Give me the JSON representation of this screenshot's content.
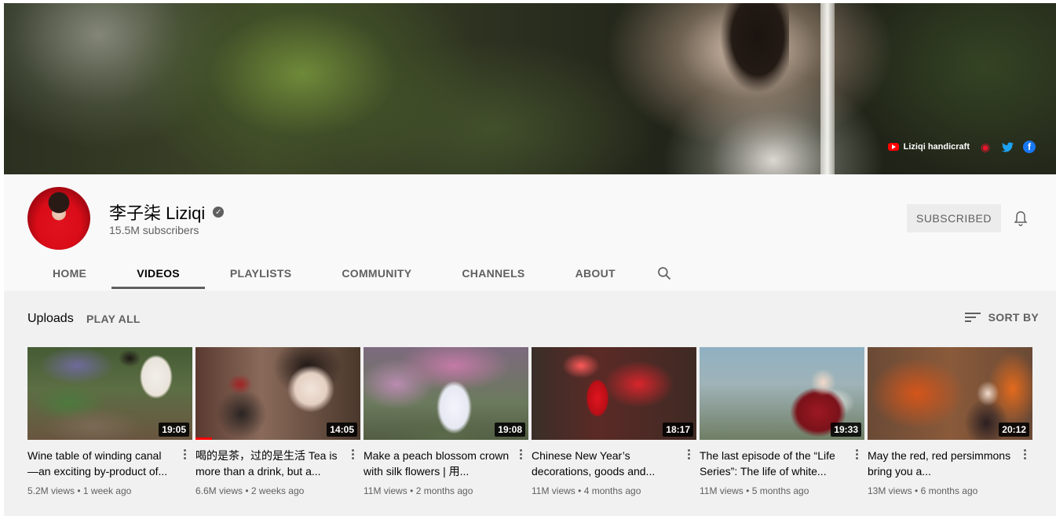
{
  "banner": {
    "links": [
      {
        "icon": "youtube-icon",
        "label": "Liziqi handicraft"
      },
      {
        "icon": "weibo-icon"
      },
      {
        "icon": "twitter-icon"
      },
      {
        "icon": "facebook-icon"
      }
    ]
  },
  "channel": {
    "name": "李子柒 Liziqi",
    "subscribers": "15.5M subscribers",
    "subscribe_button": "SUBSCRIBED",
    "verified_glyph": "✓"
  },
  "tabs": [
    {
      "label": "HOME",
      "active": false
    },
    {
      "label": "VIDEOS",
      "active": true
    },
    {
      "label": "PLAYLISTS",
      "active": false
    },
    {
      "label": "COMMUNITY",
      "active": false
    },
    {
      "label": "CHANNELS",
      "active": false
    },
    {
      "label": "ABOUT",
      "active": false
    }
  ],
  "uploads": {
    "label": "Uploads",
    "play_all": "PLAY ALL",
    "sort_by": "SORT BY"
  },
  "videos": [
    {
      "title": "Wine table of winding canal —an exciting by-product of...",
      "duration": "19:05",
      "views": "5.2M views",
      "age": "1 week ago"
    },
    {
      "title": "喝的是茶，过的是生活 Tea is more than a drink, but a...",
      "duration": "14:05",
      "views": "6.6M views",
      "age": "2 weeks ago",
      "watched_fraction": 0.1
    },
    {
      "title": "Make a peach blossom crown with silk flowers | 用...",
      "duration": "19:08",
      "views": "11M views",
      "age": "2 months ago"
    },
    {
      "title": "Chinese New Year’s decorations, goods and...",
      "duration": "18:17",
      "views": "11M views",
      "age": "4 months ago"
    },
    {
      "title": "The last episode of the “Life Series”: The life of white...",
      "duration": "19:33",
      "views": "11M views",
      "age": "5 months ago"
    },
    {
      "title": "May the red, red persimmons bring you a...",
      "duration": "20:12",
      "views": "13M views",
      "age": "6 months ago"
    }
  ],
  "meta_separator": "•"
}
